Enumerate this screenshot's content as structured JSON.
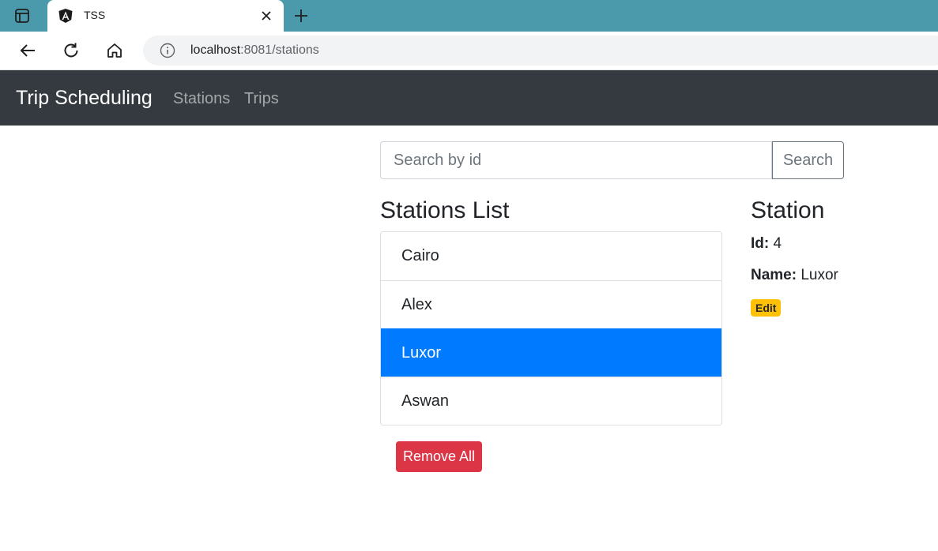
{
  "browser": {
    "tab_title": "TSS",
    "url_host": "localhost",
    "url_rest": ":8081/stations"
  },
  "navbar": {
    "brand": "Trip Scheduling",
    "links": [
      "Stations",
      "Trips"
    ]
  },
  "search": {
    "placeholder": "Search by id",
    "button_label": "Search"
  },
  "stations_list": {
    "title": "Stations List",
    "items": [
      "Cairo",
      "Alex",
      "Luxor",
      "Aswan"
    ],
    "selected": "Luxor",
    "remove_all_label": "Remove All"
  },
  "station_details": {
    "title": "Station",
    "id_label": "Id:",
    "id_value": "4",
    "name_label": "Name:",
    "name_value": "Luxor",
    "edit_label": "Edit"
  },
  "colors": {
    "navbar": "#343a40",
    "active_item": "#007bff",
    "danger": "#dc3545",
    "warning": "#ffc107",
    "tabstrip": "#4a9aab"
  },
  "icons": [
    "sidebar-toggle-icon",
    "angular-logo-icon",
    "close-icon",
    "plus-icon",
    "back-arrow-icon",
    "reload-icon",
    "home-icon",
    "info-icon"
  ]
}
